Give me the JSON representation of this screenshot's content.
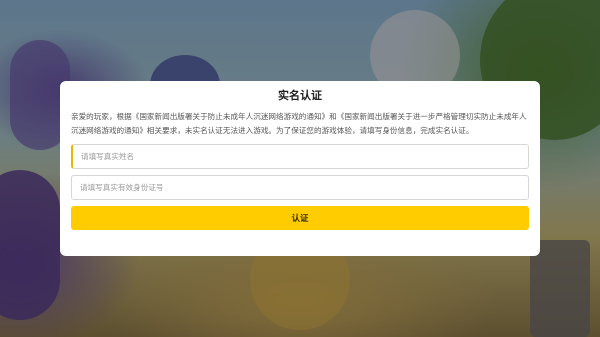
{
  "dialog": {
    "title": "实名认证",
    "body": "亲爱的玩家，根据《国家新闻出版署关于防止未成年人沉迷网络游戏的通知》和《国家新闻出版署关于进一步严格管理切实防止未成年人沉迷网络游戏的通知》相关要求，未实名认证无法进入游戏。为了保证您的游戏体验，请填写身份信息，完成实名认证。",
    "name_field": {
      "value": "",
      "placeholder": "请填写真实姓名"
    },
    "id_field": {
      "value": "",
      "placeholder": "请填写真实有效身份证号"
    },
    "submit_label": "认证"
  },
  "colors": {
    "accent": "#ffcc00",
    "overlay": "rgba(0,0,0,0.35)"
  }
}
